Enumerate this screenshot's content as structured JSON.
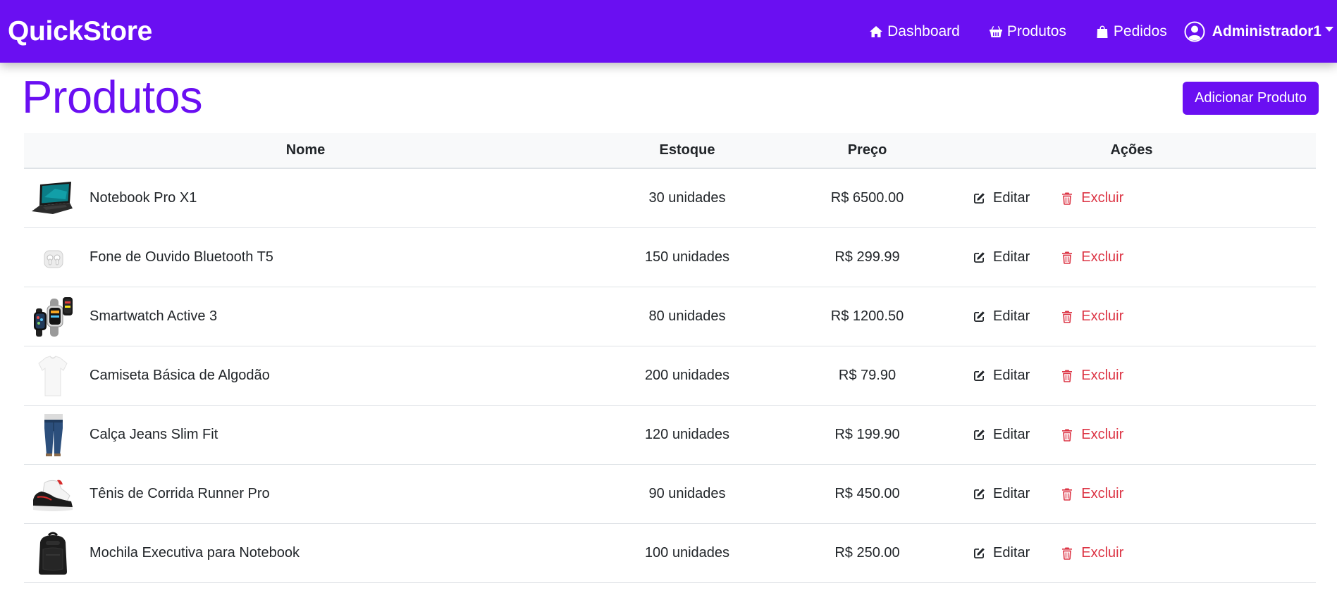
{
  "brand": "QuickStore",
  "nav": {
    "dashboard": "Dashboard",
    "products": "Produtos",
    "orders": "Pedidos",
    "user": "Administrador1"
  },
  "page": {
    "title": "Produtos",
    "add_button": "Adicionar Produto"
  },
  "table": {
    "headers": [
      "Nome",
      "Estoque",
      "Preço",
      "Ações"
    ],
    "edit_label": "Editar",
    "delete_label": "Excluir",
    "rows": [
      {
        "name": "Notebook Pro X1",
        "stock": "30 unidades",
        "price": "R$ 6500.00",
        "image": "laptop-image"
      },
      {
        "name": "Fone de Ouvido Bluetooth T5",
        "stock": "150 unidades",
        "price": "R$ 299.99",
        "image": "earbuds-image"
      },
      {
        "name": "Smartwatch Active 3",
        "stock": "80 unidades",
        "price": "R$ 1200.50",
        "image": "smartwatch-image"
      },
      {
        "name": "Camiseta Básica de Algodão",
        "stock": "200 unidades",
        "price": "R$ 79.90",
        "image": "tshirt-image"
      },
      {
        "name": "Calça Jeans Slim Fit",
        "stock": "120 unidades",
        "price": "R$ 199.90",
        "image": "jeans-image"
      },
      {
        "name": "Tênis de Corrida Runner Pro",
        "stock": "90 unidades",
        "price": "R$ 450.00",
        "image": "sneaker-image"
      },
      {
        "name": "Mochila Executiva para Notebook",
        "stock": "100 unidades",
        "price": "R$ 250.00",
        "image": "backpack-image"
      }
    ]
  },
  "colors": {
    "primary": "#6a0ff2",
    "danger": "#dc3545",
    "header_bg": "#f8f9fa"
  }
}
